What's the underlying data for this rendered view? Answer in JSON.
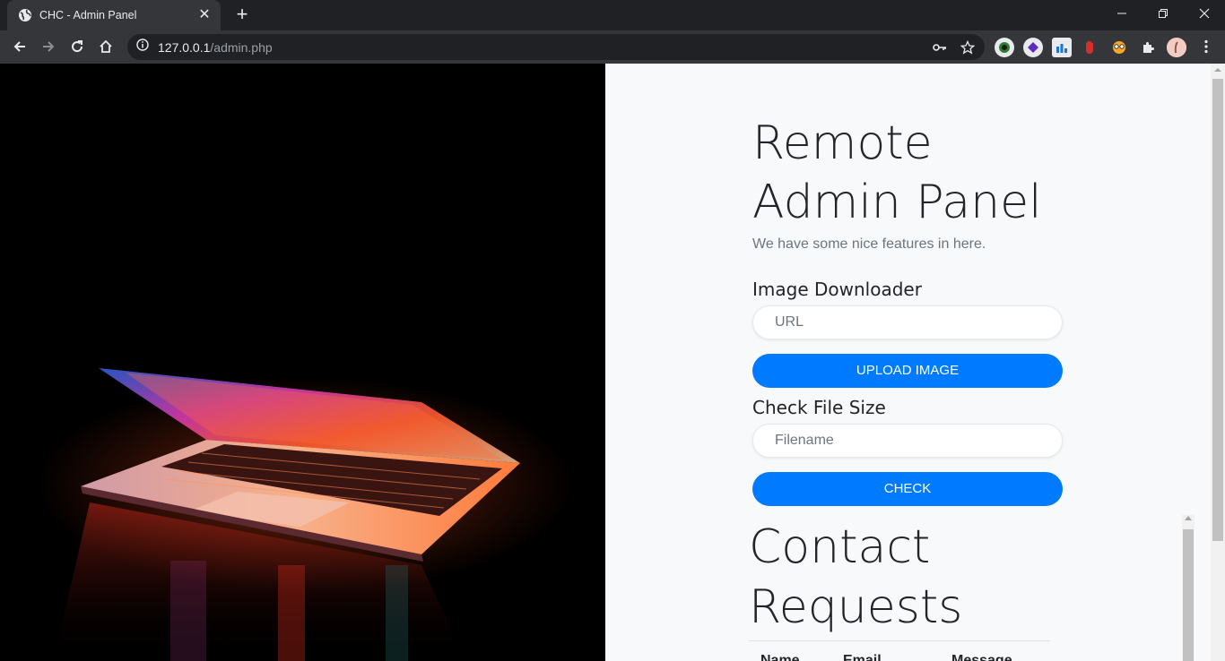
{
  "browser": {
    "tab_title": "CHC - Admin Panel",
    "url_host": "127.0.0.1",
    "url_path": "/admin.php",
    "colors": {
      "frame": "#202124",
      "toolbar": "#35363a"
    }
  },
  "page": {
    "heading": "Remote Admin Panel",
    "lead": "We have some nice features in here.",
    "image_downloader": {
      "label": "Image Downloader",
      "url_placeholder": "URL",
      "button_label": "UPLOAD IMAGE"
    },
    "file_size": {
      "label": "Check File Size",
      "filename_placeholder": "Filename",
      "button_label": "CHECK"
    },
    "contact": {
      "heading": "Contact Requests",
      "columns": [
        "Name",
        "Email",
        "Message"
      ]
    },
    "colors": {
      "primary": "#007bff",
      "background": "#f8f9fa"
    }
  }
}
